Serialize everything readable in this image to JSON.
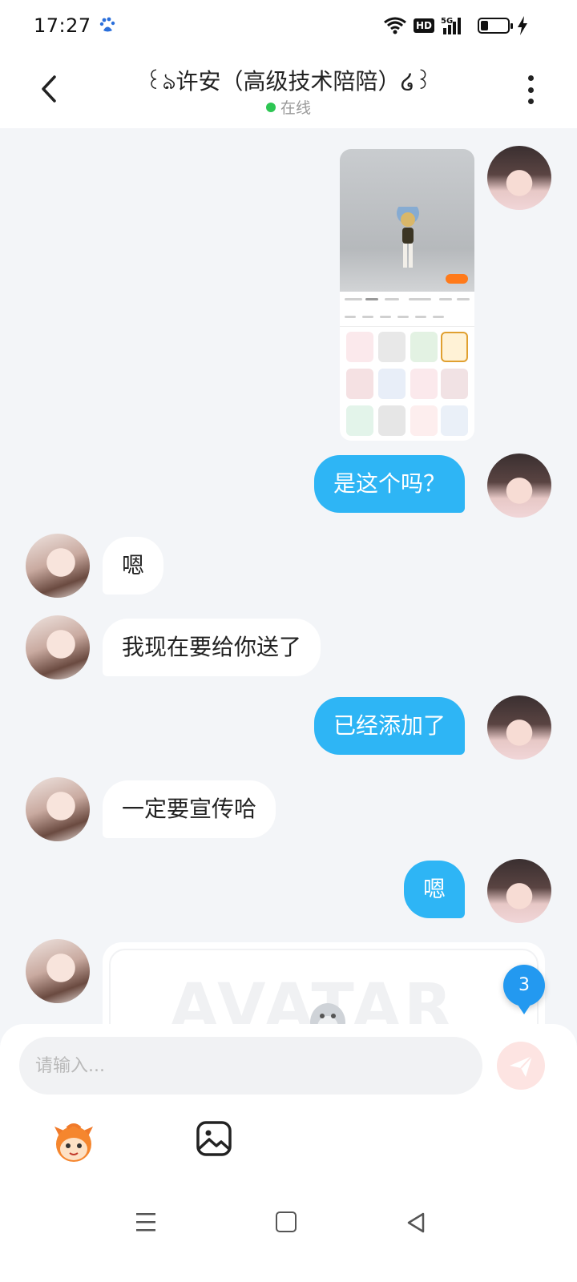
{
  "status_bar": {
    "time": "17:27",
    "icons": [
      "baidu-icon",
      "wifi-icon",
      "hd-icon",
      "5g-signal-icon",
      "battery-icon",
      "charging-icon"
    ],
    "hd_label": "HD",
    "network_label": "5G"
  },
  "header": {
    "title": "꒰ঌ许安（高级技术陪陪）໒꒱",
    "status": "在线"
  },
  "messages": [
    {
      "side": "right",
      "type": "image"
    },
    {
      "side": "right",
      "text": "是这个吗？"
    },
    {
      "side": "left",
      "text": "嗯"
    },
    {
      "side": "left",
      "text": "我现在要给你送了"
    },
    {
      "side": "right",
      "text": "已经添加了"
    },
    {
      "side": "left",
      "text": "一定要宣传哈"
    },
    {
      "side": "right",
      "text": "嗯"
    },
    {
      "side": "left",
      "type": "card",
      "watermark": "AVATAR"
    }
  ],
  "unread_count": "3",
  "composer": {
    "placeholder": "请输入..."
  },
  "colors": {
    "accent": "#2eb5f5",
    "online": "#2dc653",
    "badge": "#2399f0",
    "send": "#fde4e2"
  }
}
